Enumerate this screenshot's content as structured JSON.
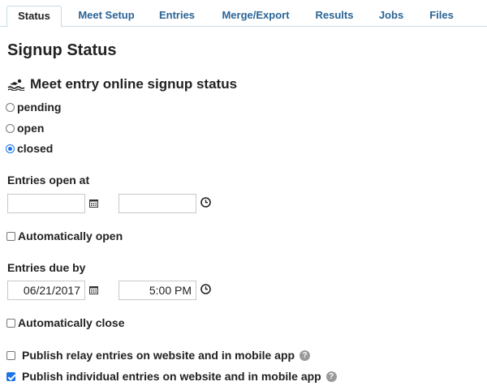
{
  "tabs": [
    {
      "label": "Status",
      "active": true
    },
    {
      "label": "Meet Setup"
    },
    {
      "label": "Entries"
    },
    {
      "label": "Merge/Export"
    },
    {
      "label": "Results"
    },
    {
      "label": "Jobs"
    },
    {
      "label": "Files"
    }
  ],
  "page_title": "Signup Status",
  "section": {
    "icon": "swimmer-icon",
    "title": "Meet entry online signup status"
  },
  "status_options": [
    {
      "label": "pending",
      "checked": false
    },
    {
      "label": "open",
      "checked": false
    },
    {
      "label": "closed",
      "checked": true
    }
  ],
  "entries_open": {
    "label": "Entries open at",
    "date_value": "",
    "time_value": "",
    "auto_label": "Automatically open",
    "auto_checked": false
  },
  "entries_due": {
    "label": "Entries due by",
    "date_value": "06/21/2017",
    "time_value": "5:00 PM",
    "auto_label": "Automatically close",
    "auto_checked": false
  },
  "publish": {
    "relay_label": "Publish relay entries on website and in mobile app",
    "relay_checked": false,
    "individual_label": "Publish individual entries on website and in mobile app",
    "individual_checked": true,
    "help_glyph": "?"
  },
  "colors": {
    "link": "#2a6496",
    "accent": "#1a73e8",
    "tab_border": "#c9dbe6"
  }
}
